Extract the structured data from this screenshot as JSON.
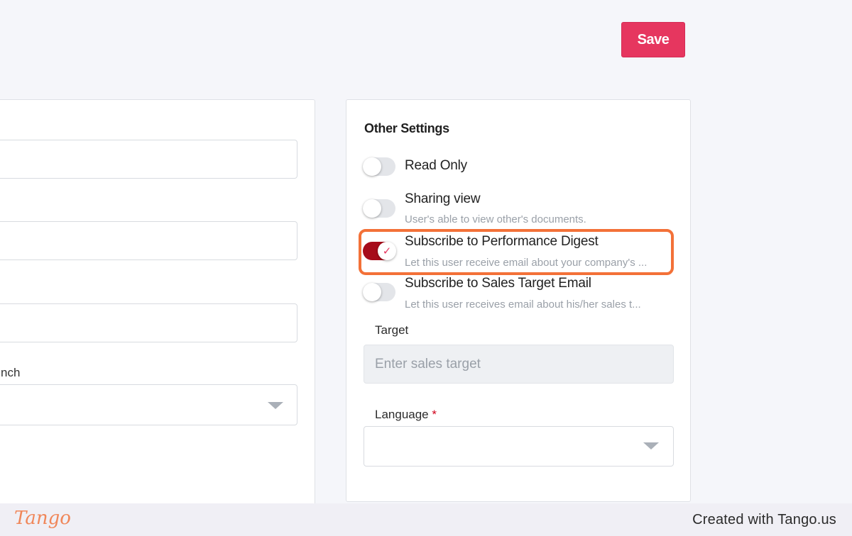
{
  "toolbar": {
    "save_label": "Save"
  },
  "left_form": {
    "branch_label_fragment": "nch"
  },
  "other_settings": {
    "title": "Other Settings",
    "options": [
      {
        "title": "Read Only",
        "description": "",
        "enabled": false
      },
      {
        "title": "Sharing view",
        "description": "User's able to view other's documents.",
        "enabled": false
      },
      {
        "title": "Subscribe to Performance Digest",
        "description": "Let this user receive email about your company's ...",
        "enabled": true
      },
      {
        "title": "Subscribe to Sales Target Email",
        "description": "Let this user receives email about his/her sales t...",
        "enabled": false
      }
    ],
    "target": {
      "label": "Target",
      "placeholder": "Enter sales target",
      "value": ""
    },
    "language": {
      "label": "Language",
      "required_mark": "*",
      "value": ""
    }
  },
  "footer": {
    "logo_text": "Tango",
    "credit": "Created with Tango.us"
  },
  "colors": {
    "accent": "#e6365f",
    "toggle_on": "#a60b1a",
    "highlight": "#f37138"
  },
  "icons": [
    "chevron-down-icon",
    "check-icon"
  ]
}
